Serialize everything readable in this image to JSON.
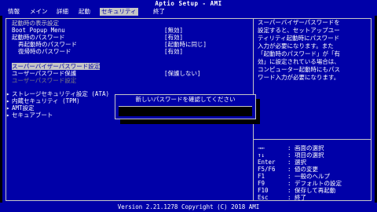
{
  "header": {
    "title": "Aptio Setup - AMI"
  },
  "tabs": [
    {
      "label": "情報"
    },
    {
      "label": "メイン"
    },
    {
      "label": "詳細"
    },
    {
      "label": "起動"
    },
    {
      "label": "セキュリティ"
    },
    {
      "label": "終了"
    }
  ],
  "settings": {
    "boot_display_heading": "起動時の表示設定",
    "boot_popup_menu": {
      "label": "Boot Popup Menu",
      "value": "[無効]"
    },
    "boot_password": {
      "label": "起動時のパスワード",
      "value": "[有効]"
    },
    "reboot_password": {
      "label": "再起動時のパスワード",
      "value": "[起動時に同じ]"
    },
    "resume_password": {
      "label": "復帰時のパスワード",
      "value": "[有効]"
    },
    "supervisor_password": {
      "label": "スーパーバイザーパスワード設定"
    },
    "user_password_protect": {
      "label": "ユーザーパスワード保護",
      "value": "[保護しない]"
    },
    "user_password_set": {
      "label": "ユーザーパスワード設定"
    },
    "storage_security": {
      "label": "ストレージセキュリティ設定 (ATA)"
    },
    "internal_security": {
      "label": "内蔵セキュリティ (TPM)"
    },
    "amt": {
      "label": "AMT設定"
    },
    "secure_boot": {
      "label": "セキュアブート"
    }
  },
  "help": {
    "lines": [
      "スーパーバイザーパスワードを",
      "設定すると、セットアップユー",
      "ティリティ起動時にパスワード",
      "入力が必要になります。また",
      "「起動時のパスワード」が「有",
      "効」に設定されている場合は、",
      "コンピューター起動時にもパス",
      "ワード入力が必要になります。"
    ]
  },
  "keys": [
    {
      "key": "→←",
      "desc": ": 画面の選択"
    },
    {
      "key": "↑↓",
      "desc": ": 項目の選択"
    },
    {
      "key": "Enter",
      "desc": ": 選択"
    },
    {
      "key": "F5/F6",
      "desc": ": 値の変更"
    },
    {
      "key": "F1",
      "desc": ": 一般のヘルプ"
    },
    {
      "key": "F9",
      "desc": ": デフォルトの設定"
    },
    {
      "key": "F10",
      "desc": ": 保存して再起動"
    },
    {
      "key": "Esc",
      "desc": ": 終了"
    }
  ],
  "dialog": {
    "title": "新しいパスワードを確認してください",
    "input_value": ""
  },
  "footer": {
    "version": "Version 2.21.1278 Copyright (C) 2018 AMI"
  },
  "colors": {
    "background": "#0000a8",
    "highlight": "#c6c6c6",
    "text": "#ffffff",
    "disabled": "#7d7d7d"
  }
}
